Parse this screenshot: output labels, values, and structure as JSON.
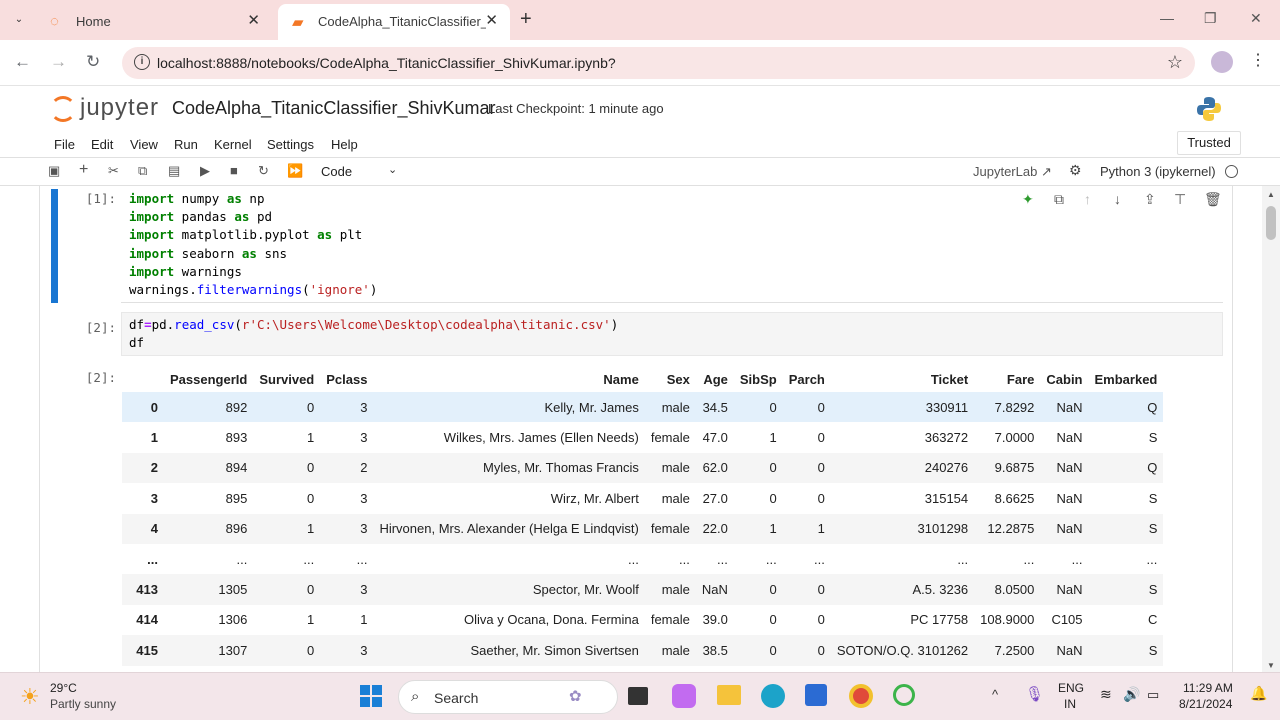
{
  "browser": {
    "tabs": [
      {
        "label": "Home",
        "active": false
      },
      {
        "label": "CodeAlpha_TitanicClassifier_ShivKumar",
        "active": true
      }
    ],
    "url": "localhost:8888/notebooks/CodeAlpha_TitanicClassifier_ShivKumar.ipynb?"
  },
  "jupyter": {
    "logo_text": "jupyter",
    "notebook_name": "CodeAlpha_TitanicClassifier_ShivKumar",
    "checkpoint": "Last Checkpoint: 1 minute ago",
    "menu": [
      "File",
      "Edit",
      "View",
      "Run",
      "Kernel",
      "Settings",
      "Help"
    ],
    "trusted": "Trusted",
    "cell_type": "Code",
    "jupyterlab_link": "JupyterLab",
    "kernel": "Python 3 (ipykernel)"
  },
  "cells": [
    {
      "prompt": "[1]:",
      "type": "code"
    },
    {
      "prompt": "[2]:",
      "type": "code"
    },
    {
      "prompt": "[2]:",
      "type": "output"
    }
  ],
  "dataframe": {
    "columns": [
      "PassengerId",
      "Survived",
      "Pclass",
      "Name",
      "Sex",
      "Age",
      "SibSp",
      "Parch",
      "Ticket",
      "Fare",
      "Cabin",
      "Embarked"
    ],
    "rows": [
      {
        "index": "0",
        "cells": [
          "892",
          "0",
          "3",
          "Kelly, Mr. James",
          "male",
          "34.5",
          "0",
          "0",
          "330911",
          "7.8292",
          "NaN",
          "Q"
        ]
      },
      {
        "index": "1",
        "cells": [
          "893",
          "1",
          "3",
          "Wilkes, Mrs. James (Ellen Needs)",
          "female",
          "47.0",
          "1",
          "0",
          "363272",
          "7.0000",
          "NaN",
          "S"
        ]
      },
      {
        "index": "2",
        "cells": [
          "894",
          "0",
          "2",
          "Myles, Mr. Thomas Francis",
          "male",
          "62.0",
          "0",
          "0",
          "240276",
          "9.6875",
          "NaN",
          "Q"
        ]
      },
      {
        "index": "3",
        "cells": [
          "895",
          "0",
          "3",
          "Wirz, Mr. Albert",
          "male",
          "27.0",
          "0",
          "0",
          "315154",
          "8.6625",
          "NaN",
          "S"
        ]
      },
      {
        "index": "4",
        "cells": [
          "896",
          "1",
          "3",
          "Hirvonen, Mrs. Alexander (Helga E Lindqvist)",
          "female",
          "22.0",
          "1",
          "1",
          "3101298",
          "12.2875",
          "NaN",
          "S"
        ]
      },
      {
        "index": "...",
        "cells": [
          "...",
          "...",
          "...",
          "...",
          "...",
          "...",
          "...",
          "...",
          "...",
          "...",
          "...",
          "..."
        ]
      },
      {
        "index": "413",
        "cells": [
          "1305",
          "0",
          "3",
          "Spector, Mr. Woolf",
          "male",
          "NaN",
          "0",
          "0",
          "A.5. 3236",
          "8.0500",
          "NaN",
          "S"
        ]
      },
      {
        "index": "414",
        "cells": [
          "1306",
          "1",
          "1",
          "Oliva y Ocana, Dona. Fermina",
          "female",
          "39.0",
          "0",
          "0",
          "PC 17758",
          "108.9000",
          "C105",
          "C"
        ]
      },
      {
        "index": "415",
        "cells": [
          "1307",
          "0",
          "3",
          "Saether, Mr. Simon Sivertsen",
          "male",
          "38.5",
          "0",
          "0",
          "SOTON/O.Q. 3101262",
          "7.2500",
          "NaN",
          "S"
        ]
      }
    ]
  },
  "taskbar": {
    "temperature": "29°C",
    "weather": "Partly sunny",
    "search_placeholder": "Search",
    "lang_top": "ENG",
    "lang_bottom": "IN",
    "time": "11:29 AM",
    "date": "8/21/2024"
  }
}
